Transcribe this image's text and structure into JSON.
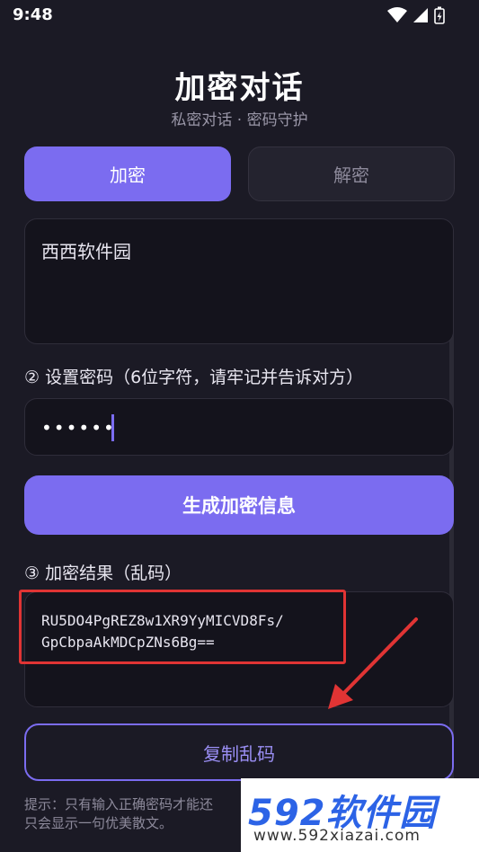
{
  "status": {
    "time": "9:48"
  },
  "header": {
    "title": "加密对话",
    "subtitle": "私密对话 · 密码守护"
  },
  "tabs": [
    {
      "label": "加密",
      "active": true
    },
    {
      "label": "解密",
      "active": false
    }
  ],
  "message": {
    "value": "西西软件园"
  },
  "password": {
    "label": "② 设置密码（6位字符，请牢记并告诉对方）",
    "masked_value": "••••••"
  },
  "generate_button": {
    "label": "生成加密信息"
  },
  "result": {
    "label": "③ 加密结果（乱码）",
    "line1": "RU5DO4PgREZ8w1XR9YyMICVD8Fs/",
    "line2": "GpCbpaAkMDCpZNs6Bg=="
  },
  "copy_button": {
    "label": "复制乱码"
  },
  "hint": {
    "line1": "提示：只有输入正确密码才能还",
    "line2": "只会显示一句优美散文。"
  },
  "watermark": {
    "brand": "592软件园",
    "url": "www.592xiazai.com"
  },
  "colors": {
    "accent": "#7b6cf0",
    "background": "#1b1a25",
    "highlight": "#e03434"
  }
}
